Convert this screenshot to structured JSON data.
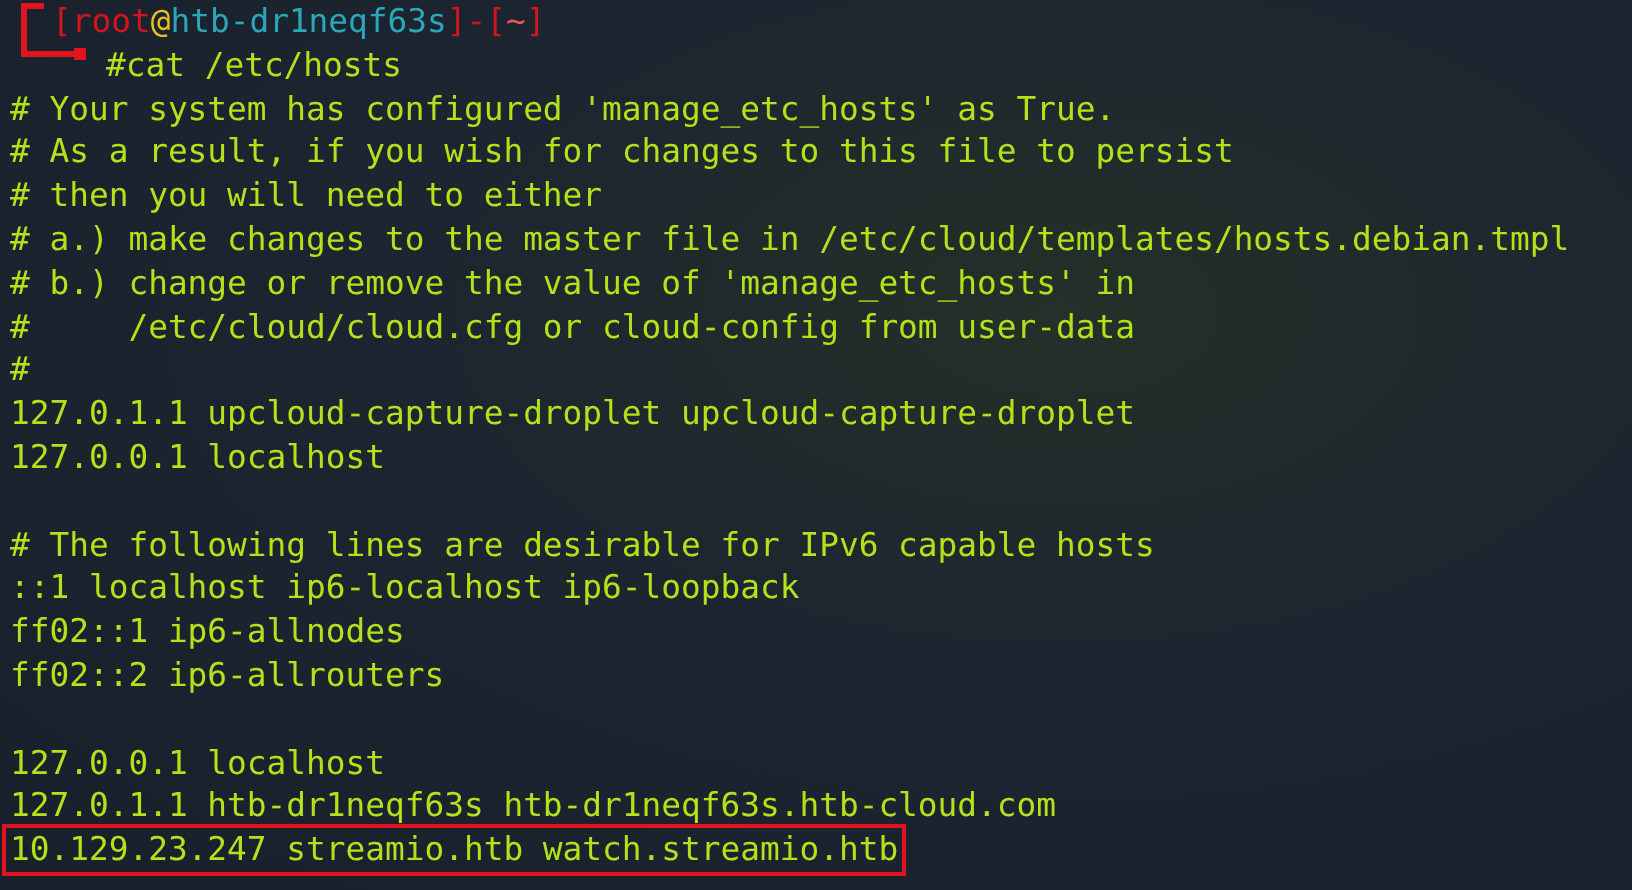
{
  "prompt": {
    "segments": [
      {
        "kind": "bracket",
        "text": "["
      },
      {
        "kind": "user",
        "text": "root"
      },
      {
        "kind": "at",
        "text": "@"
      },
      {
        "kind": "host",
        "text": "htb-dr1neqf63s"
      },
      {
        "kind": "bracket",
        "text": "]-["
      },
      {
        "kind": "dir",
        "text": "~"
      },
      {
        "kind": "bracket",
        "text": "]"
      }
    ],
    "command": "#cat /etc/hosts"
  },
  "output": [
    {
      "kind": "text",
      "text": "# Your system has configured 'manage_etc_hosts' as True.",
      "highlighted": false
    },
    {
      "kind": "text",
      "text": "# As a result, if you wish for changes to this file to persist",
      "highlighted": false
    },
    {
      "kind": "text",
      "text": "# then you will need to either",
      "highlighted": false
    },
    {
      "kind": "text",
      "text": "# a.) make changes to the master file in /etc/cloud/templates/hosts.debian.tmpl",
      "highlighted": false
    },
    {
      "kind": "text",
      "text": "# b.) change or remove the value of 'manage_etc_hosts' in",
      "highlighted": false
    },
    {
      "kind": "text",
      "text": "#     /etc/cloud/cloud.cfg or cloud-config from user-data",
      "highlighted": false
    },
    {
      "kind": "text",
      "text": "#",
      "highlighted": false
    },
    {
      "kind": "text",
      "text": "127.0.1.1 upcloud-capture-droplet upcloud-capture-droplet",
      "highlighted": false
    },
    {
      "kind": "text",
      "text": "127.0.0.1 localhost",
      "highlighted": false
    },
    {
      "kind": "blank"
    },
    {
      "kind": "text",
      "text": "# The following lines are desirable for IPv6 capable hosts",
      "highlighted": false
    },
    {
      "kind": "text",
      "text": "::1 localhost ip6-localhost ip6-loopback",
      "highlighted": false
    },
    {
      "kind": "text",
      "text": "ff02::1 ip6-allnodes",
      "highlighted": false
    },
    {
      "kind": "text",
      "text": "ff02::2 ip6-allrouters",
      "highlighted": false
    },
    {
      "kind": "blank"
    },
    {
      "kind": "text",
      "text": "127.0.0.1 localhost",
      "highlighted": false
    },
    {
      "kind": "text",
      "text": "127.0.1.1 htb-dr1neqf63s htb-dr1neqf63s.htb-cloud.com",
      "highlighted": false
    },
    {
      "kind": "text",
      "text": "10.129.23.247 streamio.htb watch.streamio.htb",
      "highlighted": true
    }
  ]
}
